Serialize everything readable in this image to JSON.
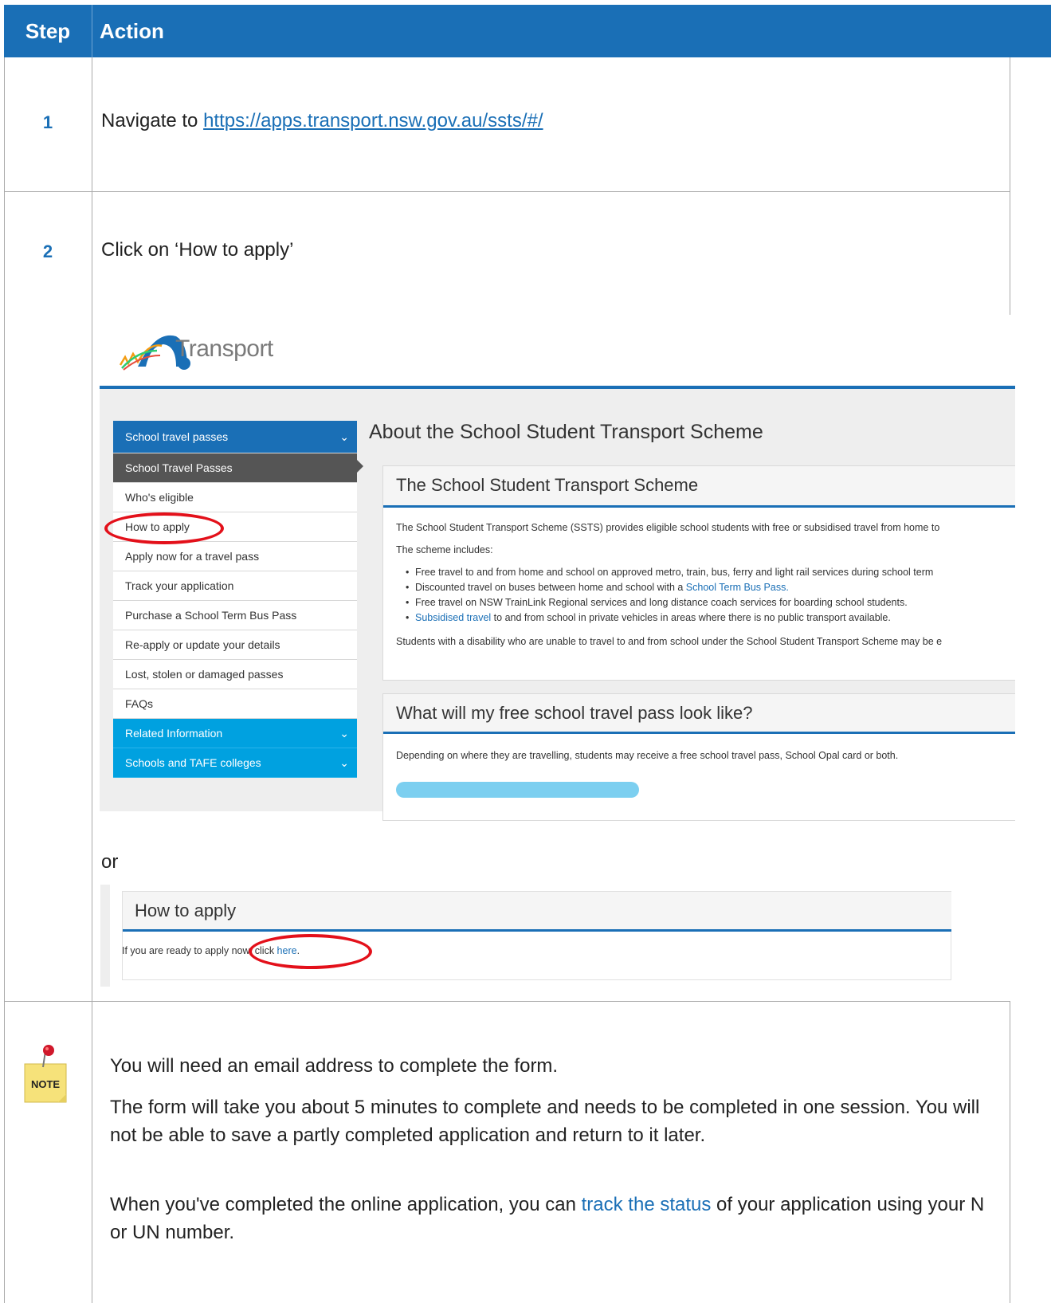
{
  "header": {
    "step_label": "Step",
    "action_label": "Action"
  },
  "steps": [
    {
      "number": "1",
      "text": "Navigate to ",
      "link": "https://apps.transport.nsw.gov.au/ssts/#/"
    },
    {
      "number": "2",
      "text": "Click on ‘How to apply’"
    }
  ],
  "screenshot1": {
    "logo_text": "Transport",
    "sidebar": [
      "School travel passes",
      "School Travel Passes",
      "Who's eligible",
      "How to apply",
      "Apply now for a travel pass",
      "Track your application",
      "Purchase a School Term Bus Pass",
      "Re-apply or update your details",
      "Lost, stolen or damaged passes",
      "FAQs",
      "Related Information",
      "Schools and TAFE colleges"
    ],
    "page_title": "About the School Student Transport Scheme",
    "card1": {
      "heading": "The School Student Transport Scheme",
      "intro": "The School Student Transport Scheme (SSTS) provides eligible school students with free or subsidised travel from home to",
      "includes": "The scheme includes:",
      "bullets": [
        {
          "pre": "Free travel to and from home and school on approved metro, train, bus, ferry and light rail services during school term",
          "link": "",
          "post": ""
        },
        {
          "pre": "Discounted travel on buses between home and school with a ",
          "link": "School Term Bus Pass.",
          "post": ""
        },
        {
          "pre": "Free travel on NSW TrainLink Regional services and long distance coach services for boarding school students.",
          "link": "",
          "post": ""
        },
        {
          "pre": "",
          "link": "Subsidised travel",
          "post": " to and from school in private vehicles in areas where there is no public transport available."
        }
      ],
      "disability": "Students with a disability who are unable to travel to and from school under the School Student Transport Scheme may be e"
    },
    "card2": {
      "heading": "What will my free school travel pass look like?",
      "text": "Depending on where they are travelling, students may receive a free school travel pass, School Opal card or both."
    }
  },
  "or_text": "or",
  "screenshot2": {
    "heading": "How to apply",
    "text_pre": "If you are ready to apply now, click ",
    "link": "here",
    "text_post": "."
  },
  "note": {
    "icon_label": "NOTE",
    "p1": "You will need an email address to complete the form.",
    "p2": "The form will take you about 5 minutes to complete and needs to be completed in one session. You will not be able to save a partly completed application and return to it later.",
    "p3_pre": "When you've completed the online application, you can ",
    "p3_link": "track the status",
    "p3_post": " of your application using your N or UN number."
  },
  "colors": {
    "header_blue": "#1a6fb6",
    "cyan": "#00a1e0",
    "highlight_red": "#e3101a"
  }
}
